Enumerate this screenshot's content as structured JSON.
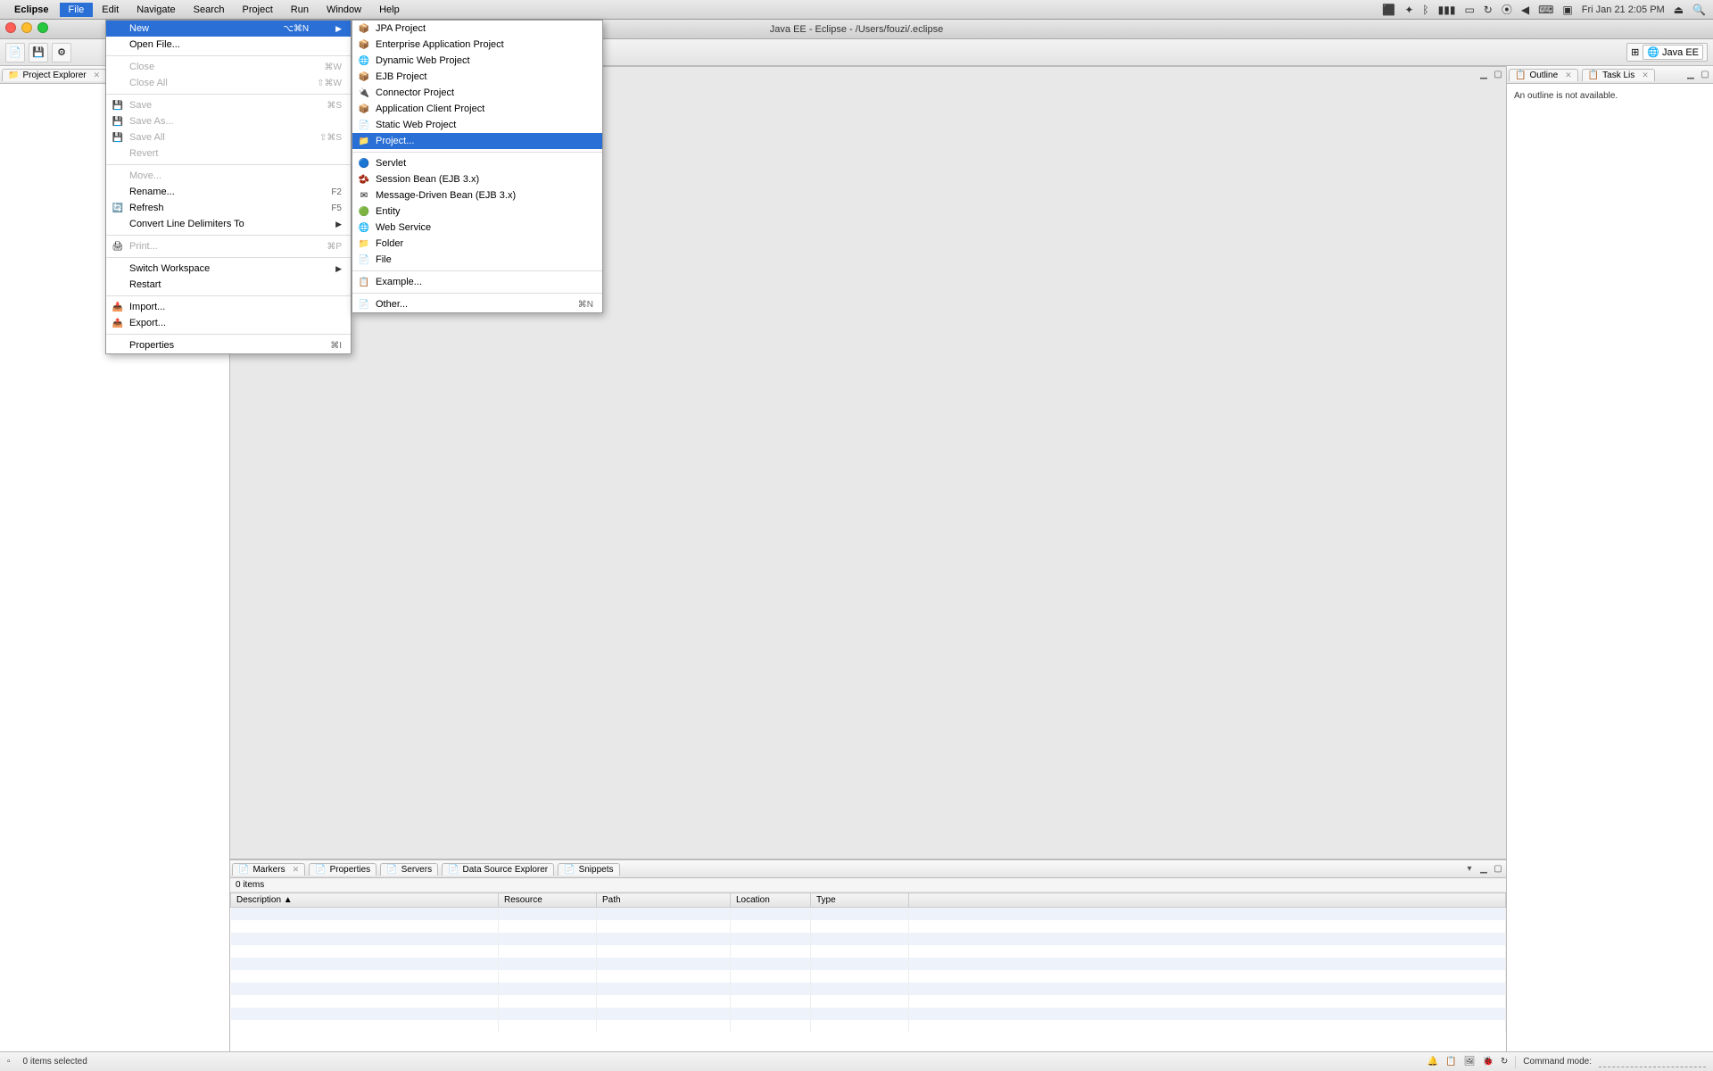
{
  "mac_menu": {
    "appname": "Eclipse",
    "items": [
      "File",
      "Edit",
      "Navigate",
      "Search",
      "Project",
      "Run",
      "Window",
      "Help"
    ],
    "active_index": 0,
    "datetime": "Fri Jan 21  2:05 PM"
  },
  "window": {
    "title": "Java EE - Eclipse - /Users/fouzi/.eclipse"
  },
  "perspective": {
    "label": "Java EE"
  },
  "left_view": {
    "tab": "Project Explorer"
  },
  "right_view": {
    "tabs": [
      "Outline",
      "Task Lis"
    ],
    "empty_text": "An outline is not available."
  },
  "bottom_tabs": [
    "Markers",
    "Properties",
    "Servers",
    "Data Source Explorer",
    "Snippets"
  ],
  "markers": {
    "count_label": "0 items",
    "columns": [
      "Description",
      "Resource",
      "Path",
      "Location",
      "Type"
    ]
  },
  "status": {
    "selection": "0 items selected",
    "command_mode_label": "Command mode:"
  },
  "file_menu": [
    {
      "label": "New",
      "shortcut": "⌥⌘N",
      "arrow": true,
      "highlight": true
    },
    {
      "label": "Open File..."
    },
    {
      "divider": true
    },
    {
      "label": "Close",
      "shortcut": "⌘W",
      "disabled": true
    },
    {
      "label": "Close All",
      "shortcut": "⇧⌘W",
      "disabled": true
    },
    {
      "divider": true
    },
    {
      "label": "Save",
      "shortcut": "⌘S",
      "icon": "💾",
      "disabled": true
    },
    {
      "label": "Save As...",
      "icon": "💾",
      "disabled": true
    },
    {
      "label": "Save All",
      "shortcut": "⇧⌘S",
      "icon": "💾",
      "disabled": true
    },
    {
      "label": "Revert",
      "disabled": true
    },
    {
      "divider": true
    },
    {
      "label": "Move...",
      "disabled": true
    },
    {
      "label": "Rename...",
      "shortcut": "F2"
    },
    {
      "label": "Refresh",
      "shortcut": "F5",
      "icon": "🔄"
    },
    {
      "label": "Convert Line Delimiters To",
      "arrow": true
    },
    {
      "divider": true
    },
    {
      "label": "Print...",
      "shortcut": "⌘P",
      "icon": "🖨",
      "disabled": true
    },
    {
      "divider": true
    },
    {
      "label": "Switch Workspace",
      "arrow": true
    },
    {
      "label": "Restart"
    },
    {
      "divider": true
    },
    {
      "label": "Import...",
      "icon": "📥"
    },
    {
      "label": "Export...",
      "icon": "📤"
    },
    {
      "divider": true
    },
    {
      "label": "Properties",
      "shortcut": "⌘I"
    }
  ],
  "new_submenu": [
    {
      "label": "JPA Project",
      "icon": "📦"
    },
    {
      "label": "Enterprise Application Project",
      "icon": "📦"
    },
    {
      "label": "Dynamic Web Project",
      "icon": "🌐"
    },
    {
      "label": "EJB Project",
      "icon": "📦"
    },
    {
      "label": "Connector Project",
      "icon": "🔌"
    },
    {
      "label": "Application Client Project",
      "icon": "📦"
    },
    {
      "label": "Static Web Project",
      "icon": "📄"
    },
    {
      "label": "Project...",
      "icon": "📁",
      "highlight": true
    },
    {
      "divider": true
    },
    {
      "label": "Servlet",
      "icon": "🔵"
    },
    {
      "label": "Session Bean (EJB 3.x)",
      "icon": "🫘"
    },
    {
      "label": "Message-Driven Bean (EJB 3.x)",
      "icon": "✉"
    },
    {
      "label": "Entity",
      "icon": "🟢"
    },
    {
      "label": "Web Service",
      "icon": "🌐"
    },
    {
      "label": "Folder",
      "icon": "📁"
    },
    {
      "label": "File",
      "icon": "📄"
    },
    {
      "divider": true
    },
    {
      "label": "Example...",
      "icon": "📋"
    },
    {
      "divider": true
    },
    {
      "label": "Other...",
      "shortcut": "⌘N",
      "icon": "📄"
    }
  ]
}
